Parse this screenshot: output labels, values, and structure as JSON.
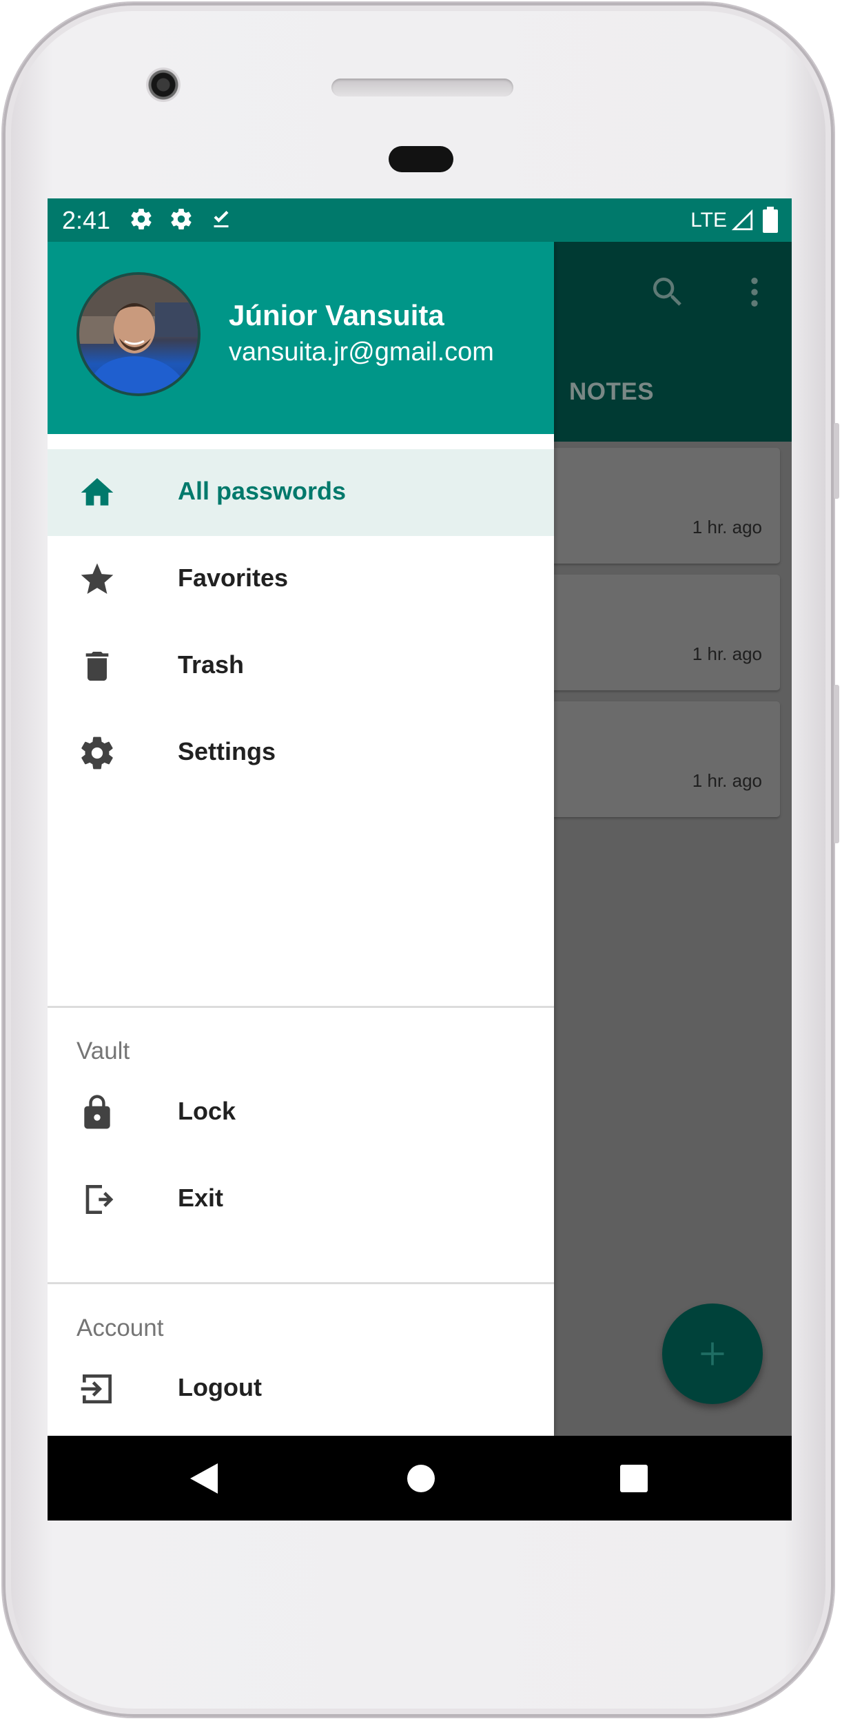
{
  "status_bar": {
    "time": "2:41",
    "network": "LTE",
    "icons": [
      "settings-icon",
      "settings-icon",
      "download-done-icon",
      "signal-icon",
      "battery-icon"
    ]
  },
  "drawer": {
    "user": {
      "name": "Júnior Vansuita",
      "email": "vansuita.jr@gmail.com"
    },
    "items": [
      {
        "label": "All passwords",
        "icon": "home-icon",
        "active": true
      },
      {
        "label": "Favorites",
        "icon": "star-icon",
        "active": false
      },
      {
        "label": "Trash",
        "icon": "trash-icon",
        "active": false
      },
      {
        "label": "Settings",
        "icon": "gear-icon",
        "active": false
      }
    ],
    "vault": {
      "title": "Vault",
      "items": [
        {
          "label": "Lock",
          "icon": "lock-icon"
        },
        {
          "label": "Exit",
          "icon": "exit-icon"
        }
      ]
    },
    "account": {
      "title": "Account",
      "items": [
        {
          "label": "Logout",
          "icon": "logout-icon"
        }
      ]
    }
  },
  "background_app": {
    "tab_label": "NOTES",
    "cards": [
      {
        "time": "1 hr. ago"
      },
      {
        "time": "1 hr. ago"
      },
      {
        "time": "1 hr. ago"
      }
    ],
    "fab_icon": "plus-icon"
  },
  "colors": {
    "primary": "#009688",
    "primary_dark": "#00796b",
    "accent_active_bg": "#e6f1ef",
    "scrim": "#5f5f5f"
  }
}
